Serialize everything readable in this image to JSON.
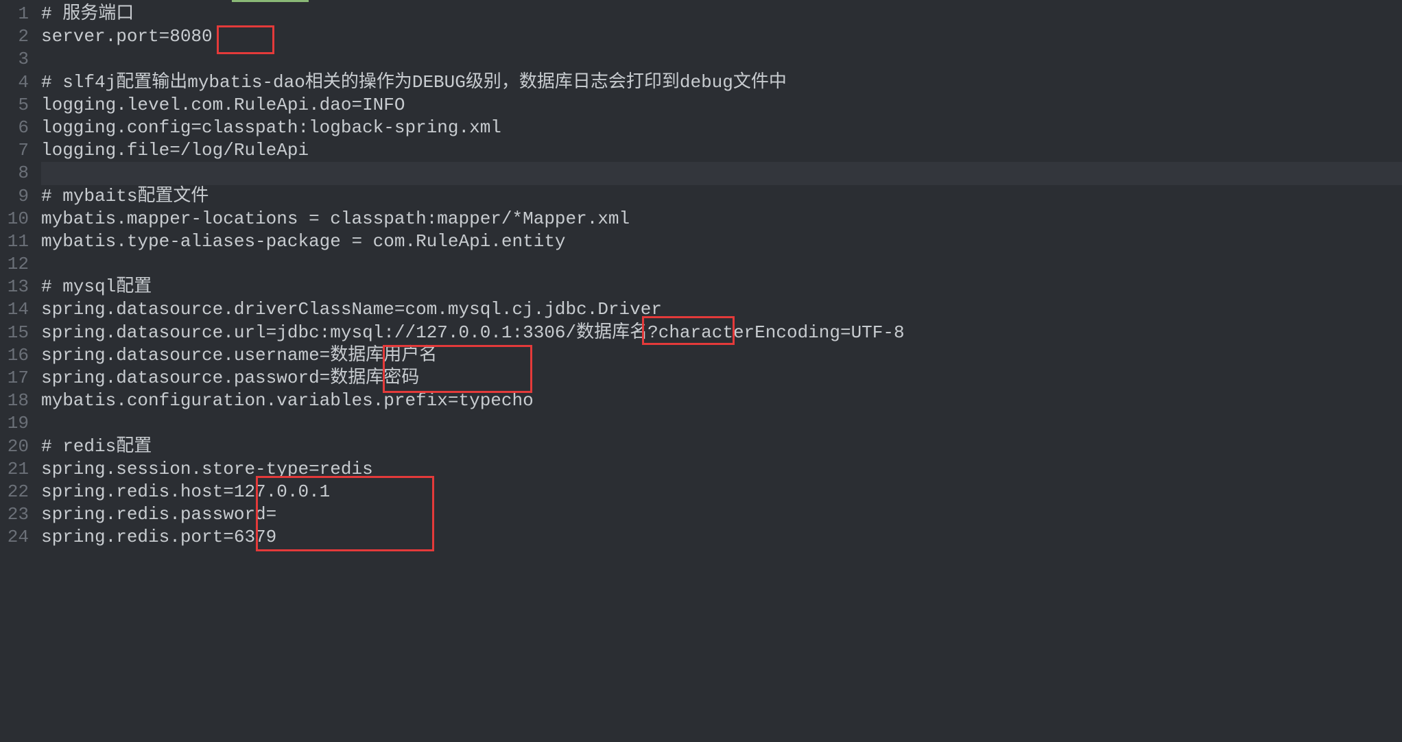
{
  "lines": {
    "l1": "# 服务端口",
    "l2": "server.port=8080",
    "l3": "",
    "l4": "# slf4j配置输出mybatis-dao相关的操作为DEBUG级别，数据库日志会打印到debug文件中",
    "l5": "logging.level.com.RuleApi.dao=INFO",
    "l6": "logging.config=classpath:logback-spring.xml",
    "l7": "logging.file=/log/RuleApi",
    "l8": "",
    "l9": "# mybaits配置文件",
    "l10": "mybatis.mapper-locations = classpath:mapper/*Mapper.xml",
    "l11": "mybatis.type-aliases-package = com.RuleApi.entity",
    "l12": "",
    "l13": "# mysql配置",
    "l14": "spring.datasource.driverClassName=com.mysql.cj.jdbc.Driver",
    "l15": "spring.datasource.url=jdbc:mysql://127.0.0.1:3306/数据库名?characterEncoding=UTF-8",
    "l16": "spring.datasource.username=数据库用户名",
    "l17": "spring.datasource.password=数据库密码",
    "l18": "mybatis.configuration.variables.prefix=typecho",
    "l19": "",
    "l20": "# redis配置",
    "l21": "spring.session.store-type=redis",
    "l22": "spring.redis.host=127.0.0.1",
    "l23": "spring.redis.password=",
    "l24": "spring.redis.port=6379"
  },
  "lineNumbers": {
    "n1": "1",
    "n2": "2",
    "n3": "3",
    "n4": "4",
    "n5": "5",
    "n6": "6",
    "n7": "7",
    "n8": "8",
    "n9": "9",
    "n10": "10",
    "n11": "11",
    "n12": "12",
    "n13": "13",
    "n14": "14",
    "n15": "15",
    "n16": "16",
    "n17": "17",
    "n18": "18",
    "n19": "19",
    "n20": "20",
    "n21": "21",
    "n22": "22",
    "n23": "23",
    "n24": "24"
  },
  "highlights": {
    "port": "8080",
    "dbname": "数据库名",
    "dbuser": "数据库用户名",
    "dbpass": "数据库密码",
    "redishost": "127.0.0.1",
    "redispass": "",
    "redisport": "6379"
  }
}
